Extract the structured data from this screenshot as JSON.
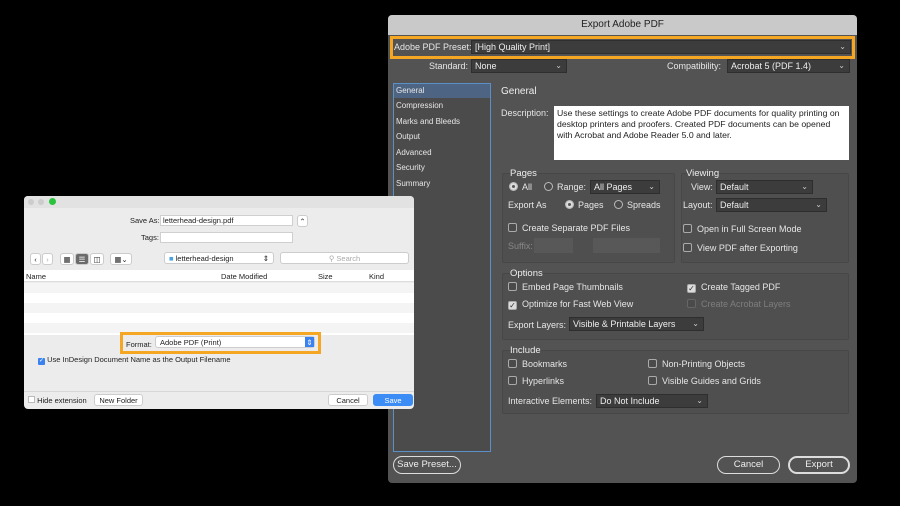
{
  "pdf_dialog": {
    "title": "Export Adobe PDF",
    "preset_label": "Adobe PDF Preset:",
    "preset_value": "[High Quality Print]",
    "standard_label": "Standard:",
    "standard_value": "None",
    "compat_label": "Compatibility:",
    "compat_value": "Acrobat 5 (PDF 1.4)",
    "sidebar": [
      "General",
      "Compression",
      "Marks and Bleeds",
      "Output",
      "Advanced",
      "Security",
      "Summary"
    ],
    "section_title": "General",
    "description_label": "Description:",
    "description": "Use these settings to create Adobe PDF documents for quality printing on desktop printers and proofers.  Created PDF documents can be opened with Acrobat and Adobe Reader 5.0 and later.",
    "pages": {
      "title": "Pages",
      "all": "All",
      "range": "Range:",
      "range_value": "All Pages",
      "export_as": "Export As",
      "pages_opt": "Pages",
      "spreads_opt": "Spreads",
      "separate": "Create Separate PDF Files",
      "suffix": "Suffix:"
    },
    "viewing": {
      "title": "Viewing",
      "view_label": "View:",
      "view_value": "Default",
      "layout_label": "Layout:",
      "layout_value": "Default",
      "fullscreen": "Open in Full Screen Mode",
      "view_after": "View PDF after Exporting"
    },
    "options": {
      "title": "Options",
      "thumbs": "Embed Page Thumbnails",
      "fastweb": "Optimize for Fast Web View",
      "tagged": "Create Tagged PDF",
      "acrobat_layers": "Create Acrobat Layers",
      "layers_label": "Export Layers:",
      "layers_value": "Visible & Printable Layers"
    },
    "include": {
      "title": "Include",
      "bookmarks": "Bookmarks",
      "hyperlinks": "Hyperlinks",
      "nonprinting": "Non-Printing Objects",
      "guides": "Visible Guides and Grids",
      "interactive_label": "Interactive Elements:",
      "interactive_value": "Do Not Include"
    },
    "save_preset": "Save Preset...",
    "cancel": "Cancel",
    "export": "Export"
  },
  "save_dialog": {
    "save_as_label": "Save As:",
    "save_as_value": "letterhead-design.pdf",
    "tags_label": "Tags:",
    "folder": "letterhead-design",
    "search_placeholder": "Search",
    "columns": [
      "Name",
      "Date Modified",
      "Size",
      "Kind"
    ],
    "format_label": "Format:",
    "format_value": "Adobe PDF (Print)",
    "use_name": "Use InDesign Document Name as the Output Filename",
    "hide_ext": "Hide extension",
    "new_folder": "New Folder",
    "cancel": "Cancel",
    "save": "Save"
  }
}
